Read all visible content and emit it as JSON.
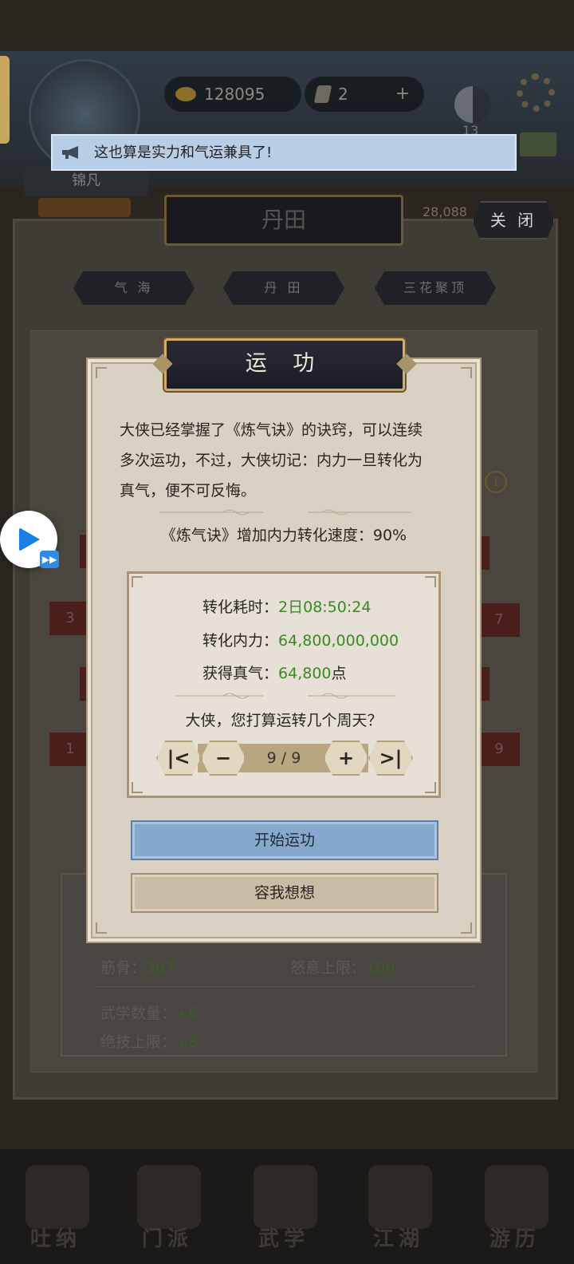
{
  "background": {
    "player_label": "",
    "gold": "128095",
    "gems": "2",
    "badge_count": "13",
    "player_name": "锦凡",
    "rank_button": "",
    "power": "28,088",
    "panel_title": "丹田",
    "close_label": "关 闭",
    "tabs": [
      "气 海",
      "丹 田",
      "三花聚顶"
    ],
    "side_slots": {
      "left_a": "3",
      "left_b": "1",
      "right_a": "7",
      "right_b": "9"
    },
    "stats": {
      "jingu_label": "筋骨：",
      "jingu_value": "367",
      "nuyi_label": "怒意上限：",
      "nuyi_value": "100",
      "wuxue_label": "武学数量：",
      "wuxue_value": "+6",
      "jueji_label": "绝技上限：",
      "jueji_value": "+8"
    },
    "story_line1": "",
    "story_line2": "",
    "nav": [
      "吐纳",
      "门派",
      "武学",
      "江湖",
      "游历"
    ]
  },
  "notice": {
    "text": "这也算是实力和气运兼具了!"
  },
  "modal": {
    "title": "运 功",
    "desc_line1": "大侠已经掌握了《炼气诀》的诀窍，可以连续",
    "desc_line2": "多次运功，不过，大侠切记：内力一旦转化为",
    "desc_line3": "真气，便不可反悔。",
    "speed_text": "《炼气诀》增加内力转化速度：90%",
    "time_label": "转化耗时：",
    "time_value": "2日08:50:24",
    "neili_label": "转化内力：",
    "neili_value": "64,800,000,000",
    "zhenqi_label": "获得真气：",
    "zhenqi_value": "64,800",
    "zhenqi_unit": "点",
    "question": "大侠，您打算运转几个周天？",
    "counter": "9 / 9",
    "btn_first": "|<",
    "btn_minus": "−",
    "btn_plus": "+",
    "btn_last": ">|",
    "start_label": "开始运功",
    "think_label": "容我想想"
  },
  "colors": {
    "accent_green": "#3a8a22",
    "start_button": "#86a8cc",
    "notice_bg": "#b8cde6",
    "title_plate": "#1c1c26"
  },
  "icons": {
    "notice": "megaphone-icon",
    "float": "play-icon"
  }
}
